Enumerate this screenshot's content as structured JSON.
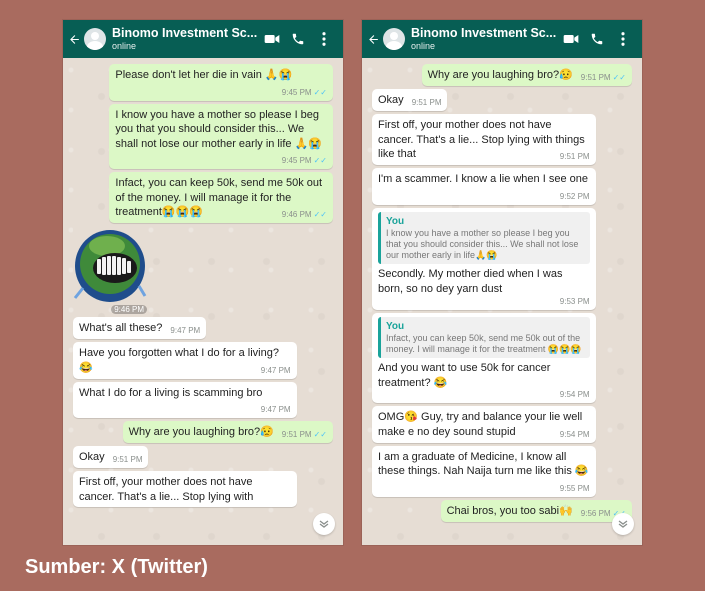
{
  "left": {
    "header": {
      "title": "Binomo Investment Sc...",
      "status": "online"
    },
    "messages": [
      {
        "type": "out",
        "text": "Please don't let her die in vain 🙏😭",
        "time": "9:45 PM",
        "ticks": "✓✓"
      },
      {
        "type": "out",
        "text": "I know you have a mother so please I beg you that you should consider this... We shall not lose our mother early in life 🙏😭",
        "time": "9:45 PM",
        "ticks": "✓✓"
      },
      {
        "type": "out",
        "text": "Infact, you can keep 50k, send me 50k out of the money. I will manage it for the treatment😭😭😭",
        "time": "9:46 PM",
        "ticks": "✓✓"
      },
      {
        "type": "sticker",
        "time": "9:46 PM"
      },
      {
        "type": "in",
        "text": "What's all these?",
        "time": "9:47 PM"
      },
      {
        "type": "in",
        "text": "Have you forgotten what I do for a living? 😂",
        "time": "9:47 PM"
      },
      {
        "type": "in",
        "text": "What I do for a living is scamming bro",
        "time": "9:47 PM"
      },
      {
        "type": "out",
        "text": "Why are you laughing bro?😥",
        "time": "9:51 PM",
        "ticks": "✓✓"
      },
      {
        "type": "in",
        "text": "Okay",
        "time": "9:51 PM"
      },
      {
        "type": "in",
        "text": "First off, your mother does not have cancer. That's a lie... Stop lying with",
        "time": ""
      }
    ]
  },
  "right": {
    "header": {
      "title": "Binomo Investment Sc...",
      "status": "online"
    },
    "messages": [
      {
        "type": "out",
        "text": "Why are you laughing bro?😥",
        "time": "9:51 PM",
        "ticks": "✓✓"
      },
      {
        "type": "in",
        "text": "Okay",
        "time": "9:51 PM"
      },
      {
        "type": "in",
        "text": "First off, your mother does not have cancer. That's a lie... Stop lying with things like that",
        "time": "9:51 PM"
      },
      {
        "type": "in",
        "text": "I'm a scammer. I know a lie when I see one",
        "time": "9:52 PM"
      },
      {
        "type": "in",
        "quote_author": "You",
        "quote_text": "I know you have a mother so please I beg you that you should consider this... We shall not lose our mother early in life🙏😭",
        "text": "Secondly. My mother died when I was born, so no dey yarn dust",
        "time": "9:53 PM"
      },
      {
        "type": "in",
        "quote_author": "You",
        "quote_text": "Infact, you can keep 50k, send me 50k out of the money. I will manage it for the treatment 😭😭😭",
        "text": "And you want to use 50k for cancer treatment? 😂",
        "time": "9:54 PM"
      },
      {
        "type": "in",
        "text": "OMG😘 Guy, try and balance your lie well make e no dey sound stupid",
        "time": "9:54 PM"
      },
      {
        "type": "in",
        "text": "I am a graduate of Medicine, I know all these things. Nah Naija turn me like this 😂",
        "time": "9:55 PM"
      },
      {
        "type": "out",
        "text": "Chai bros, you too sabi🙌",
        "time": "9:56 PM",
        "ticks": "✓✓"
      }
    ]
  },
  "icons": {
    "back": "arrow-left-icon",
    "video": "video-call-icon",
    "call": "phone-icon",
    "menu": "more-vert-icon",
    "scroll": "chevron-down-icon"
  },
  "colors": {
    "appbar": "#075e54",
    "outgoing": "#dcf8c6",
    "incoming": "#ffffff",
    "chat_bg": "#e6ddd4",
    "page_bg": "#a96b5f",
    "read_ticks": "#4fc3f7",
    "quote_accent": "#1aa39a"
  },
  "caption": "Sumber: X (Twitter)"
}
